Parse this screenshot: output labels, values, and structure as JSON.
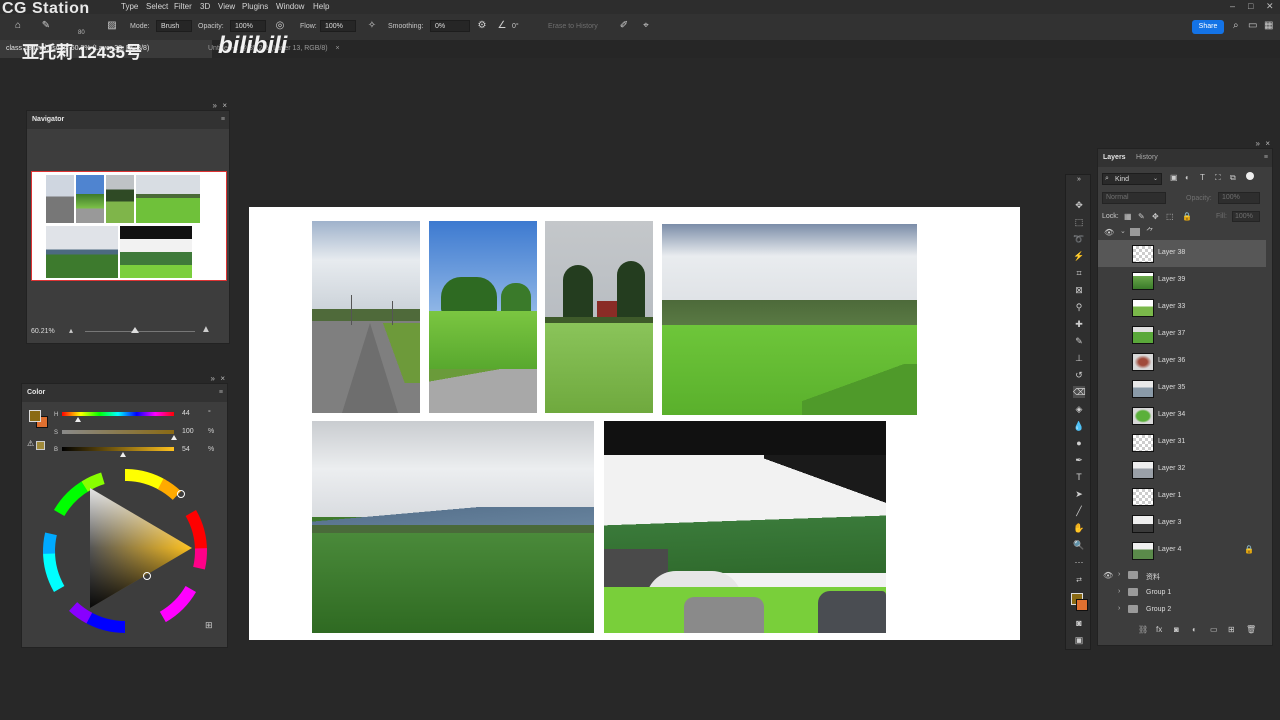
{
  "watermark": {
    "site": "CG Station",
    "bilibili_id": "亚托莉 12435号",
    "brand": "bilibili"
  },
  "menu": [
    "Type",
    "Select",
    "Filter",
    "3D",
    "View",
    "Plugins",
    "Window",
    "Help"
  ],
  "options": {
    "mode_label": "Mode:",
    "mode_value": "Brush",
    "opacity_label": "Opacity:",
    "opacity_value": "100%",
    "flow_label": "Flow:",
    "flow_value": "100%",
    "smoothing_label": "Smoothing:",
    "smoothing_value": "0%",
    "angle_value": "0°",
    "erase_history": "Erase to History",
    "brush_size": "80",
    "share": "Share"
  },
  "tabs": {
    "active": "class 18 final.psd @ 60.2% (Layer 38, RGB/8)",
    "second": "Untitled-1 @ 35.2% (Layer 13, RGB/8)"
  },
  "navigator": {
    "title": "Navigator",
    "zoom": "60.21%"
  },
  "color": {
    "title": "Color",
    "h_label": "H",
    "h_value": "44",
    "h_unit": "°",
    "s_label": "S",
    "s_value": "100",
    "s_unit": "%",
    "b_label": "B",
    "b_value": "54",
    "b_unit": "%",
    "foreground": "#8a6a14",
    "background": "#e07030"
  },
  "layers": {
    "tab_layers": "Layers",
    "tab_history": "History",
    "filter_kind": "Kind",
    "blend_mode": "Normal",
    "opacity_label": "Opacity:",
    "opacity_value": "100%",
    "lock_label": "Lock:",
    "fill_label": "Fill:",
    "fill_value": "100%",
    "items": [
      {
        "name": "Layer 38"
      },
      {
        "name": "Layer 39"
      },
      {
        "name": "Layer 33"
      },
      {
        "name": "Layer 37"
      },
      {
        "name": "Layer 36"
      },
      {
        "name": "Layer 35"
      },
      {
        "name": "Layer 34"
      },
      {
        "name": "Layer 31"
      },
      {
        "name": "Layer 32"
      },
      {
        "name": "Layer 1"
      },
      {
        "name": "Layer 3"
      },
      {
        "name": "Layer 4"
      }
    ],
    "groups": [
      {
        "name": "资料"
      },
      {
        "name": "Group 1"
      },
      {
        "name": "Group 2"
      }
    ]
  }
}
